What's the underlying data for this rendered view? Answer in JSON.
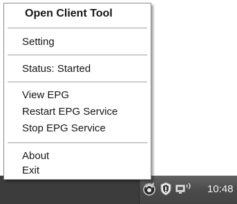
{
  "menu": {
    "items": [
      {
        "label": "Open Client Tool"
      },
      {
        "label": "Setting"
      },
      {
        "label": "Status: Started"
      },
      {
        "label": "View EPG"
      },
      {
        "label": "Restart EPG Service"
      },
      {
        "label": "Stop EPG Service"
      },
      {
        "label": "About"
      },
      {
        "label": "Exit"
      }
    ]
  },
  "tray": {
    "icons": [
      "antivirus-tray-icon",
      "shield-icon",
      "wireless-network-icon"
    ],
    "clock": "10:48"
  }
}
